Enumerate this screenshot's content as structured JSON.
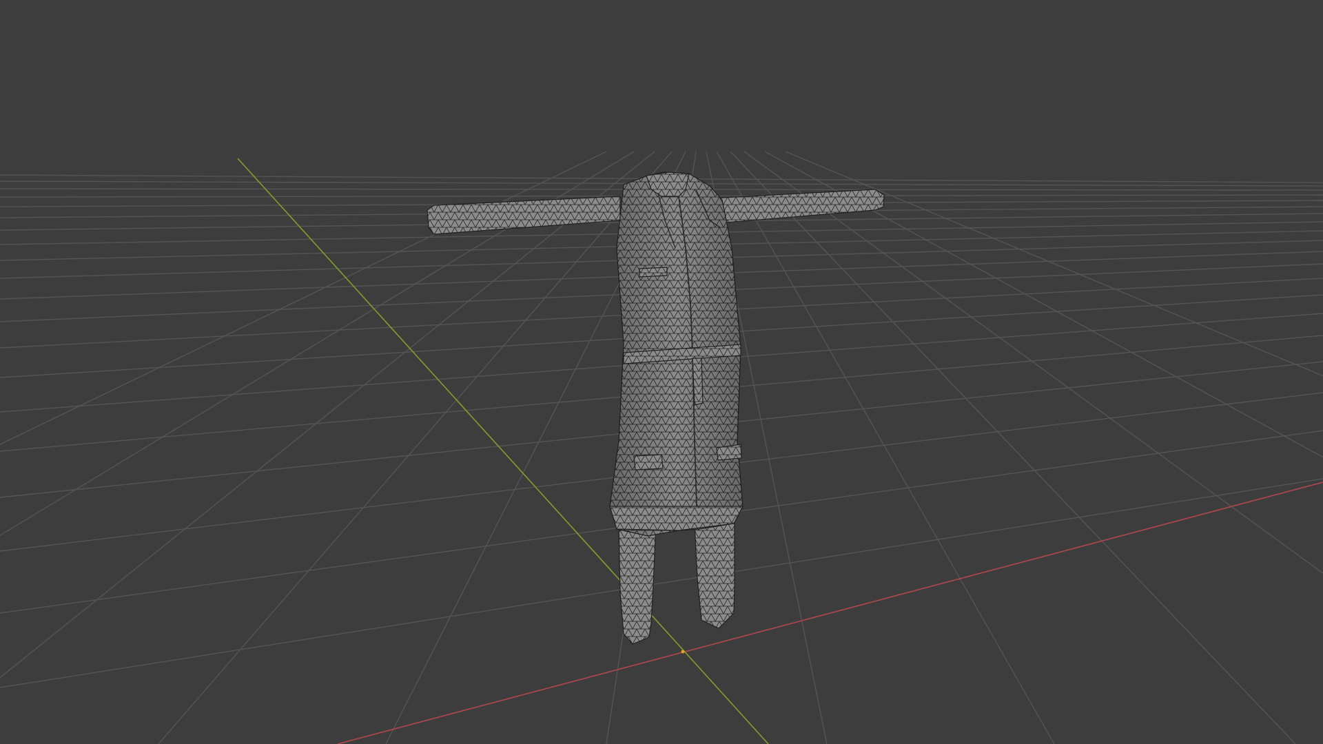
{
  "viewport": {
    "background_color": "#3d3d3d",
    "grid_color": "#555555",
    "x_axis_color": "#b5474f",
    "y_axis_color": "#7ea12c",
    "mesh_fill_color": "#8a8b8a",
    "mesh_wire_color": "#1e1f1e"
  },
  "scene": {
    "object": "garment-mesh",
    "object_description_icon": "mesh-icon"
  }
}
